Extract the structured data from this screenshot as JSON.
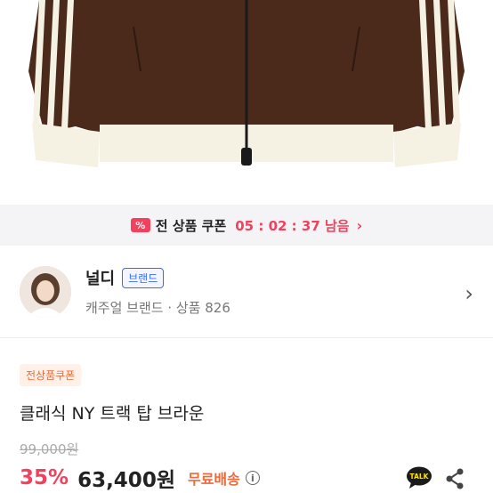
{
  "coupon_bar": {
    "icon": "coupon-icon",
    "icon_symbol": "%",
    "label": "전 상품 쿠폰",
    "timer": "05 : 02 : 37 남음",
    "chevron": "›"
  },
  "brand": {
    "name": "널디",
    "badge": "브랜드",
    "meta": "캐주얼 브랜드 · 상품 826",
    "chevron": "›"
  },
  "product": {
    "coupon_tag": "전상품쿠폰",
    "title": "클래식 NY 트랙 탑 브라운",
    "original_price": "99,000원",
    "discount": "35%",
    "sale_price": "63,400원",
    "shipping": "무료배송",
    "info_symbol": "i"
  },
  "actions": {
    "talk_label": "TALK",
    "share_icon": "share-icon"
  },
  "colors": {
    "accent_red": "#f2405d",
    "shipping_orange": "#ef6a3a",
    "brand_blue": "#3a6cf0",
    "jacket_brown": "#4a2a1a",
    "jacket_cream": "#f5f1e3"
  }
}
